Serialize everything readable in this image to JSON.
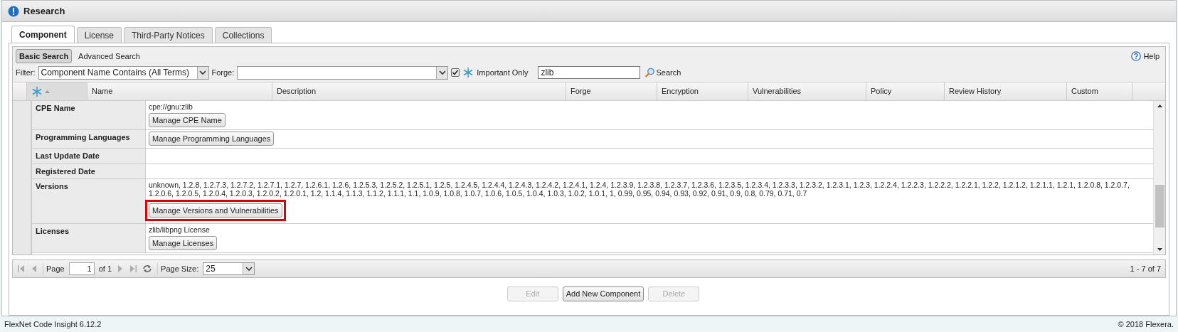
{
  "window": {
    "title": "Research"
  },
  "tabs": [
    {
      "label": "Component",
      "selected": true
    },
    {
      "label": "License",
      "selected": false
    },
    {
      "label": "Third-Party Notices",
      "selected": false
    },
    {
      "label": "Collections",
      "selected": false
    }
  ],
  "search_modes": [
    {
      "label": "Basic Search",
      "selected": true
    },
    {
      "label": "Advanced Search",
      "selected": false
    }
  ],
  "help": "Help",
  "filter": {
    "label": "Filter:",
    "value": "Component Name Contains (All Terms)"
  },
  "forge": {
    "label": "Forge:"
  },
  "important_only": {
    "label": "Important Only",
    "checked": true
  },
  "search_field": {
    "value": "zlib"
  },
  "search_button": "Search",
  "table": {
    "columns": [
      "Name",
      "Description",
      "Forge",
      "Encryption",
      "Vulnerabilities",
      "Policy",
      "Review History",
      "Custom"
    ]
  },
  "details": [
    {
      "label": "CPE Name",
      "value": "cpe://gnu:zlib",
      "button": {
        "label": "Manage CPE Name",
        "highlighted": false
      }
    },
    {
      "label": "Programming Languages",
      "button": {
        "label": "Manage Programming Languages",
        "highlighted": false
      }
    },
    {
      "label": "Last Update Date"
    },
    {
      "label": "Registered Date"
    },
    {
      "label": "Versions",
      "value": "unknown, 1.2.8, 1.2.7.3, 1.2.7.2, 1.2.7.1, 1.2.7, 1.2.6.1, 1.2.6, 1.2.5.3, 1.2.5.2, 1.2.5.1, 1.2.5, 1.2.4.5, 1.2.4.4, 1.2.4.3, 1.2.4.2, 1.2.4.1, 1.2.4, 1.2.3.9, 1.2.3.8, 1.2.3.7, 1.2.3.6, 1.2.3.5, 1.2.3.4, 1.2.3.3, 1.2.3.2, 1.2.3.1, 1.2.3, 1.2.2.4, 1.2.2.3, 1.2.2.2, 1.2.2.1, 1.2.2, 1.2.1.2, 1.2.1.1, 1.2.1, 1.2.0.8, 1.2.0.7, 1.2.0.6, 1.2.0.5, 1.2.0.4, 1.2.0.3, 1.2.0.2, 1.2.0.1, 1.2, 1.1.4, 1.1.3, 1.1.2, 1.1.1, 1.1, 1.0.9, 1.0.8, 1.0.7, 1.0.6, 1.0.5, 1.0.4, 1.0.3, 1.0.2, 1.0.1, 1, 0.99, 0.95, 0.94, 0.93, 0.92, 0.91, 0.9, 0.8, 0.79, 0.71, 0.7",
      "button": {
        "label": "Manage Versions and Vulnerabilities",
        "highlighted": true
      }
    },
    {
      "label": "Licenses",
      "value": "zlib/libpng License",
      "button": {
        "label": "Manage Licenses",
        "highlighted": false
      }
    }
  ],
  "pager": {
    "page_label": "Page",
    "page": "1",
    "of": "of 1",
    "size_label": "Page Size:",
    "size": "25",
    "summary": "1 - 7 of 7"
  },
  "actions": [
    {
      "label": "Edit",
      "disabled": true
    },
    {
      "label": "Add New Component",
      "disabled": false
    },
    {
      "label": "Delete",
      "disabled": true
    }
  ],
  "status_bar": {
    "left": "FlexNet Code Insight 6.12.2",
    "right": "© 2018 Flexera."
  }
}
